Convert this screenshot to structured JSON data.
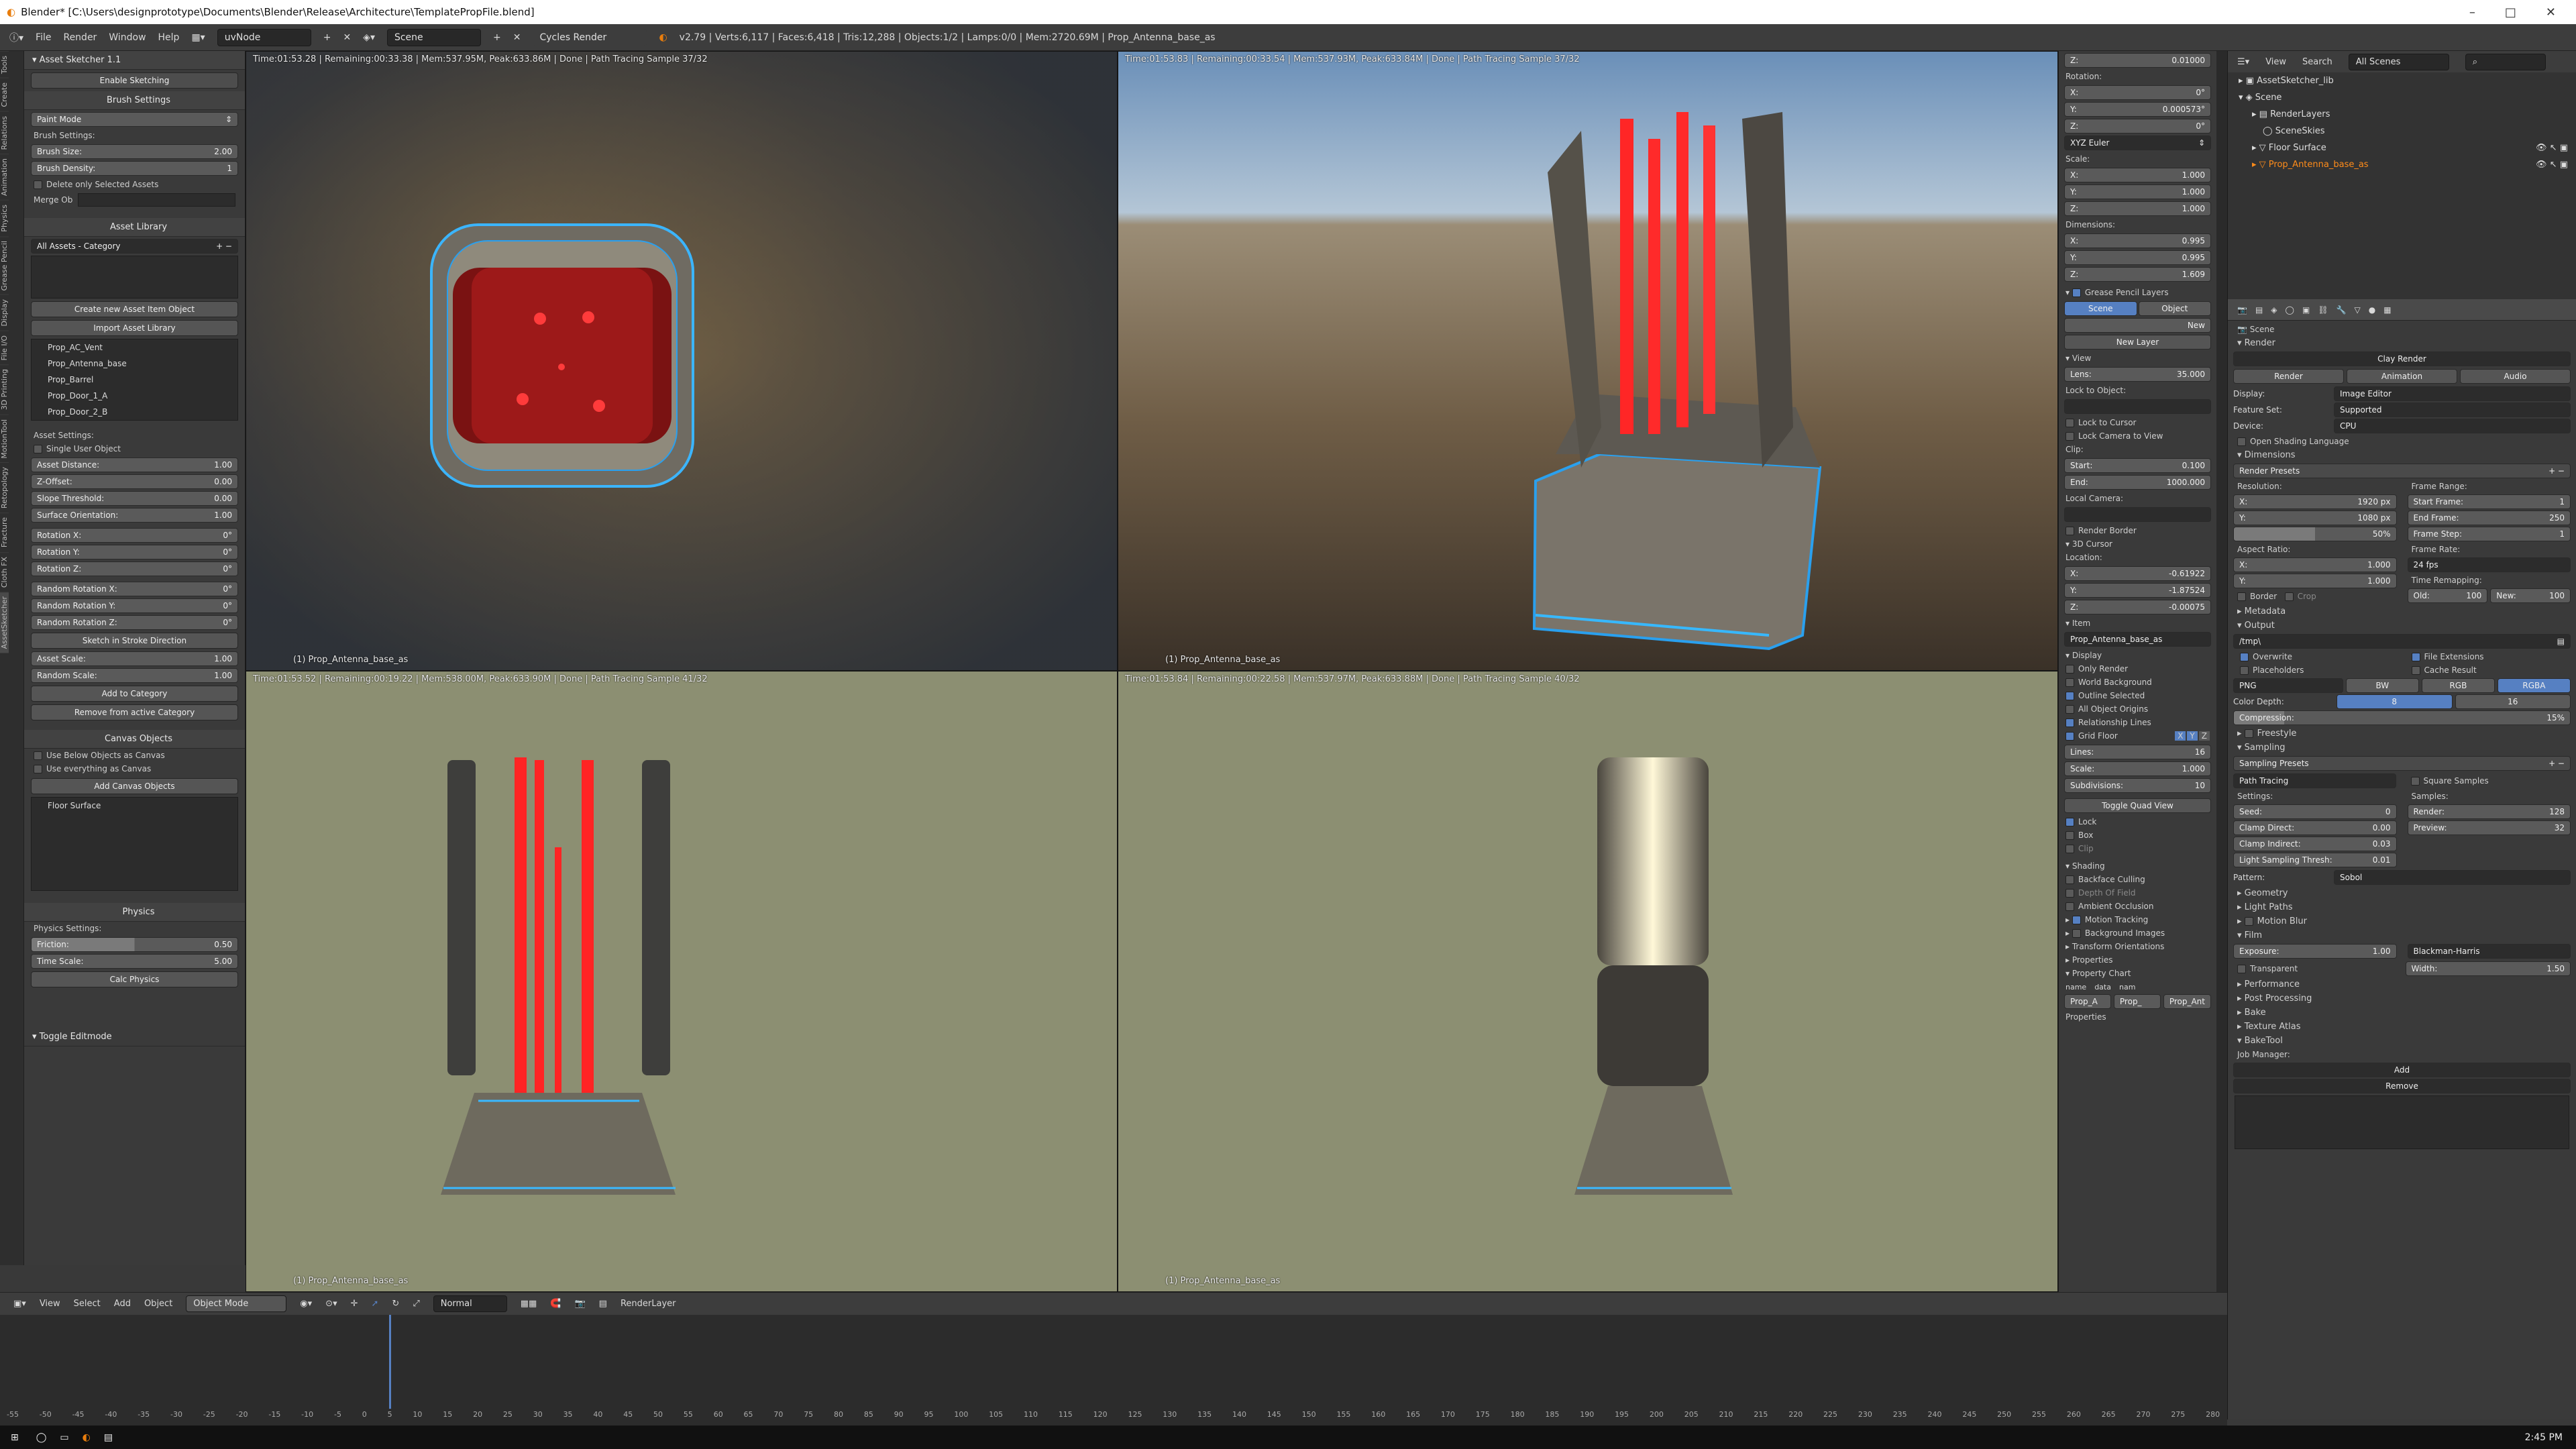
{
  "title": "Blender* [C:\\Users\\designprototype\\Documents\\Blender\\Release\\Architecture\\TemplatePropFile.blend]",
  "window_controls": [
    "–",
    "□",
    "✕"
  ],
  "menu": [
    "File",
    "Render",
    "Window",
    "Help"
  ],
  "screen_layout": "uvNode",
  "scene_name": "Scene",
  "render_engine": "Cycles Render",
  "stats": "v2.79 | Verts:6,117 | Faces:6,418 | Tris:12,288 | Objects:1/2 | Lamps:0/0 | Mem:2720.69M | Prop_Antenna_base_as",
  "tool_tabs": [
    "Tools",
    "Create",
    "Relations",
    "Animation",
    "Physics",
    "Grease Pencil",
    "Display",
    "File I/O",
    "3D Printing",
    "MotionTool",
    "Retopology",
    "Fracture",
    "Cloth FX",
    "AssetSketcher"
  ],
  "asset_sketcher": {
    "header": "Asset Sketcher 1.1",
    "enable": "Enable Sketching",
    "brush_header": "Brush Settings",
    "paint_mode": "Paint Mode",
    "brush_settings_label": "Brush Settings:",
    "brush_size_label": "Brush Size:",
    "brush_size": "2.00",
    "brush_density_label": "Brush Density:",
    "brush_density": "1",
    "delete_only_selected": "Delete only Selected Assets",
    "merge_ob": "Merge Ob",
    "library_header": "Asset Library",
    "category": "All Assets - Category",
    "create_asset_item": "Create new Asset Item Object",
    "import_library": "Import Asset Library",
    "assets": [
      "Prop_AC_Vent",
      "Prop_Antenna_base",
      "Prop_Barrel",
      "Prop_Door_1_A",
      "Prop_Door_2_B"
    ],
    "asset_settings": "Asset Settings:",
    "single_user": "Single User Object",
    "params": [
      {
        "label": "Asset Distance:",
        "value": "1.00"
      },
      {
        "label": "Z-Offset:",
        "value": "0.00"
      },
      {
        "label": "Slope Threshold:",
        "value": "0.00"
      },
      {
        "label": "Surface Orientation:",
        "value": "1.00"
      },
      {
        "label": "Rotation X:",
        "value": "0°"
      },
      {
        "label": "Rotation Y:",
        "value": "0°"
      },
      {
        "label": "Rotation Z:",
        "value": "0°"
      },
      {
        "label": "Random Rotation X:",
        "value": "0°"
      },
      {
        "label": "Random Rotation Y:",
        "value": "0°"
      },
      {
        "label": "Random Rotation Z:",
        "value": "0°"
      }
    ],
    "sketch_stroke": "Sketch in Stroke Direction",
    "asset_scale_label": "Asset Scale:",
    "asset_scale": "1.00",
    "random_scale_label": "Random Scale:",
    "random_scale": "1.00",
    "add_category": "Add to Category",
    "remove_category": "Remove from active Category",
    "canvas_header": "Canvas Objects",
    "use_below": "Use Below Objects as Canvas",
    "use_everything": "Use everything as Canvas",
    "add_canvas": "Add Canvas Objects",
    "canvas_items": [
      "Floor Surface"
    ],
    "physics_header": "Physics",
    "physics_settings": "Physics Settings:",
    "friction_label": "Friction:",
    "friction": "0.50",
    "time_scale_label": "Time Scale:",
    "time_scale": "5.00",
    "calc_physics": "Calc Physics",
    "toggle_editmode": "Toggle Editmode"
  },
  "viewports": [
    {
      "info": "Time:01:53.28 | Remaining:00:33.38 | Mem:537.95M, Peak:633.86M | Done | Path Tracing Sample 37/32",
      "object": "(1) Prop_Antenna_base_as"
    },
    {
      "info": "Time:01:53.83 | Remaining:00:33.54 | Mem:537.93M, Peak:633.84M | Done | Path Tracing Sample 37/32",
      "object": "(1) Prop_Antenna_base_as"
    },
    {
      "info": "Time:01:53.52 | Remaining:00:19.22 | Mem:538.00M, Peak:633.90M | Done | Path Tracing Sample 41/32",
      "object": "(1) Prop_Antenna_base_as"
    },
    {
      "info": "Time:01:53.84 | Remaining:00:22.58 | Mem:537.97M, Peak:633.88M | Done | Path Tracing Sample 40/32",
      "object": "(1) Prop_Antenna_base_as"
    }
  ],
  "npanel": {
    "z_loc": "0.01000",
    "rotation_label": "Rotation:",
    "rot": [
      {
        "label": "X:",
        "value": "0°"
      },
      {
        "label": "Y:",
        "value": "0.000573°"
      },
      {
        "label": "Z:",
        "value": "0°"
      }
    ],
    "rotation_mode": "XYZ Euler",
    "scale_label": "Scale:",
    "scale": [
      {
        "label": "X:",
        "value": "1.000"
      },
      {
        "label": "Y:",
        "value": "1.000"
      },
      {
        "label": "Z:",
        "value": "1.000"
      }
    ],
    "dimensions_label": "Dimensions:",
    "dims": [
      {
        "label": "X:",
        "value": "0.995"
      },
      {
        "label": "Y:",
        "value": "0.995"
      },
      {
        "label": "Z:",
        "value": "1.609"
      }
    ],
    "gp_header": "Grease Pencil Layers",
    "gp_tabs": [
      "Scene",
      "Object"
    ],
    "gp_new": "New",
    "gp_new_layer": "New Layer",
    "view_header": "View",
    "lens_label": "Lens:",
    "lens": "35.000",
    "lock_to_object": "Lock to Object:",
    "lock_cursor": "Lock to Cursor",
    "lock_camera": "Lock Camera to View",
    "clip_label": "Clip:",
    "clip_start_label": "Start:",
    "clip_start": "0.100",
    "clip_end_label": "End:",
    "clip_end": "1000.000",
    "local_camera": "Local Camera:",
    "render_border": "Render Border",
    "cursor_header": "3D Cursor",
    "location_label": "Location:",
    "cursor": [
      {
        "label": "X:",
        "value": "-0.61922"
      },
      {
        "label": "Y:",
        "value": "-1.87524"
      },
      {
        "label": "Z:",
        "value": "-0.00075"
      }
    ],
    "item_header": "Item",
    "item_name": "Prop_Antenna_base_as",
    "display_header": "Display",
    "display_opts": [
      "Only Render",
      "World Background",
      "Outline Selected",
      "All Object Origins",
      "Relationship Lines",
      "Grid Floor"
    ],
    "grid_axes": [
      "X",
      "Y",
      "Z"
    ],
    "lines_label": "Lines:",
    "lines": "16",
    "grid_scale_label": "Scale:",
    "grid_scale": "1.000",
    "subdiv_label": "Subdivisions:",
    "subdiv": "10",
    "toggle_quad": "Toggle Quad View",
    "quad_opts": [
      "Lock",
      "Box",
      "Clip"
    ],
    "shading_header": "Shading",
    "shading_opts": [
      "Backface Culling",
      "Depth Of Field",
      "Ambient Occlusion"
    ],
    "motion_tracking": "Motion Tracking",
    "collapsed": [
      "Background Images",
      "Transform Orientations",
      "Properties",
      "Property Chart"
    ],
    "chart_cols": [
      "name",
      "data",
      "nam"
    ],
    "chart_vals": [
      "Prop_A",
      "Prop_",
      "Prop_Ant"
    ],
    "properties_label": "Properties"
  },
  "outliner": {
    "menus": [
      "View",
      "Search",
      "All Scenes"
    ],
    "items": [
      "AssetSketcher_lib",
      "Scene",
      "RenderLayers",
      "SceneSkies",
      "Floor Surface",
      "Prop_Antenna_base_as"
    ]
  },
  "properties": {
    "scene": "Scene",
    "render_header": "Render",
    "clay_render": "Clay Render",
    "render_tabs": [
      "Render",
      "Animation",
      "Audio"
    ],
    "display_label": "Display:",
    "display_value": "Image Editor",
    "feature_label": "Feature Set:",
    "feature_value": "Supported",
    "device_label": "Device:",
    "device_value": "CPU",
    "osl": "Open Shading Language",
    "dimensions_header": "Dimensions",
    "render_presets": "Render Presets",
    "resolution_label": "Resolution:",
    "res_x": "1920 px",
    "res_y": "1080 px",
    "res_pct": "50%",
    "frame_range": "Frame Range:",
    "start_frame_label": "Start Frame:",
    "start_frame": "1",
    "end_frame_label": "End Frame:",
    "end_frame": "250",
    "frame_step_label": "Frame Step:",
    "frame_step": "1",
    "aspect_label": "Aspect Ratio:",
    "aspect_x": "1.000",
    "aspect_y": "1.000",
    "frame_rate_label": "Frame Rate:",
    "frame_rate": "24 fps",
    "border": "Border",
    "crop": "Crop",
    "time_remap": "Time Remapping:",
    "old_label": "Old:",
    "old": "100",
    "new_label": "New:",
    "new": "100",
    "metadata": "Metadata",
    "output_header": "Output",
    "output_path": "/tmp\\",
    "overwrite": "Overwrite",
    "file_ext": "File Extensions",
    "placeholders": "Placeholders",
    "cache_result": "Cache Result",
    "format": "PNG",
    "color_modes": [
      "BW",
      "RGB",
      "RGBA"
    ],
    "color_depth_label": "Color Depth:",
    "depth_8": "8",
    "depth_16": "16",
    "compression_label": "Compression:",
    "compression": "15%",
    "freestyle": "Freestyle",
    "sampling_header": "Sampling",
    "sampling_presets": "Sampling Presets",
    "integrator": "Path Tracing",
    "square_samples": "Square Samples",
    "settings_label": "Settings:",
    "samples_label": "Samples:",
    "seed_label": "Seed:",
    "seed": "0",
    "render_samples_label": "Render:",
    "render_samples": "128",
    "clamp_direct_label": "Clamp Direct:",
    "clamp_direct": "0.00",
    "preview_label": "Preview:",
    "preview": "32",
    "clamp_indirect_label": "Clamp Indirect:",
    "clamp_indirect": "0.03",
    "light_thresh_label": "Light Sampling Thresh:",
    "light_thresh": "0.01",
    "pattern_label": "Pattern:",
    "pattern": "Sobol",
    "collapsed_a": [
      "Geometry",
      "Light Paths",
      "Motion Blur"
    ],
    "film_header": "Film",
    "exposure_label": "Exposure:",
    "exposure": "1.00",
    "filter": "Blackman-Harris",
    "transparent": "Transparent",
    "width_label": "Width:",
    "width": "1.50",
    "collapsed_b": [
      "Performance",
      "Post Processing",
      "Bake",
      "Texture Atlas",
      "BakeTool"
    ],
    "job_manager": "Job Manager:",
    "add": "Add",
    "remove": "Remove"
  },
  "bottom_header": {
    "menus": [
      "View",
      "Select",
      "Add",
      "Object"
    ],
    "mode": "Object Mode",
    "pivot": "Normal",
    "render_layer": "RenderLayer"
  },
  "timeline": {
    "ticks": [
      "-55",
      "-50",
      "-45",
      "-40",
      "-35",
      "-30",
      "-25",
      "-20",
      "-15",
      "-10",
      "-5",
      "0",
      "5",
      "10",
      "15",
      "20",
      "25",
      "30",
      "35",
      "40",
      "45",
      "50",
      "55",
      "60",
      "65",
      "70",
      "75",
      "80",
      "85",
      "90",
      "95",
      "100",
      "105",
      "110",
      "115",
      "120",
      "125",
      "130",
      "135",
      "140",
      "145",
      "150",
      "155",
      "160",
      "165",
      "170",
      "175",
      "180",
      "185",
      "190",
      "195",
      "200",
      "205",
      "210",
      "215",
      "220",
      "225",
      "230",
      "235",
      "240",
      "245",
      "250",
      "255",
      "260",
      "265",
      "270",
      "275",
      "280"
    ]
  },
  "taskbar": {
    "time": "2:45 PM"
  },
  "colors": {
    "accent": "#5680c2",
    "selected_text": "#ff8c1a",
    "glow_red": "#ff2a2a",
    "glow_blue": "#37b8ff"
  }
}
